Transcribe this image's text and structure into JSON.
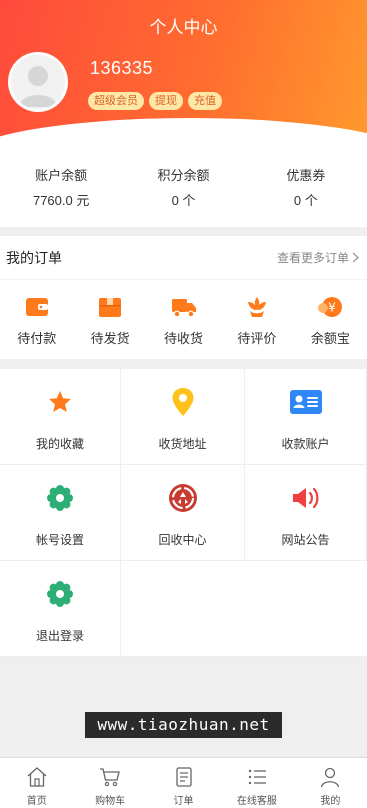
{
  "header": {
    "title": "个人中心",
    "username": "136335",
    "badges": [
      "超级会员",
      "提现",
      "充值"
    ]
  },
  "balances": [
    {
      "label": "账户余额",
      "value": "7760.0 元"
    },
    {
      "label": "积分余额",
      "value": "0 个"
    },
    {
      "label": "优惠券",
      "value": "0 个"
    }
  ],
  "orders": {
    "title": "我的订单",
    "more": "查看更多订单",
    "items": [
      {
        "label": "待付款",
        "icon": "wallet-icon"
      },
      {
        "label": "待发货",
        "icon": "box-icon"
      },
      {
        "label": "待收货",
        "icon": "truck-icon"
      },
      {
        "label": "待评价",
        "icon": "flower-icon"
      },
      {
        "label": "余额宝",
        "icon": "coin-icon"
      }
    ]
  },
  "grid": [
    {
      "label": "我的收藏",
      "icon": "star-icon"
    },
    {
      "label": "收货地址",
      "icon": "location-pin-icon"
    },
    {
      "label": "收款账户",
      "icon": "id-card-icon"
    },
    {
      "label": "帐号设置",
      "icon": "gear-icon"
    },
    {
      "label": "回收中心",
      "icon": "recycle-icon"
    },
    {
      "label": "网站公告",
      "icon": "speaker-icon"
    },
    {
      "label": "退出登录",
      "icon": "logout-gear-icon"
    }
  ],
  "watermark": "www.tiaozhuan.net",
  "tabbar": [
    {
      "label": "首页",
      "icon": "home-icon"
    },
    {
      "label": "购物车",
      "icon": "cart-icon"
    },
    {
      "label": "订单",
      "icon": "order-icon"
    },
    {
      "label": "在线客服",
      "icon": "list-icon"
    },
    {
      "label": "我的",
      "icon": "user-icon"
    }
  ],
  "colors": {
    "header_start": "#ff4a3c",
    "header_end": "#ff9a2d",
    "order_icon": "#ff7a1a",
    "badge_bg": "#ffe7a6",
    "badge_text": "#d8632a",
    "green_icon": "#2eae77",
    "blue_icon": "#2f86f6",
    "yellow_icon": "#ffc11c",
    "red_icon": "#c83b31"
  }
}
